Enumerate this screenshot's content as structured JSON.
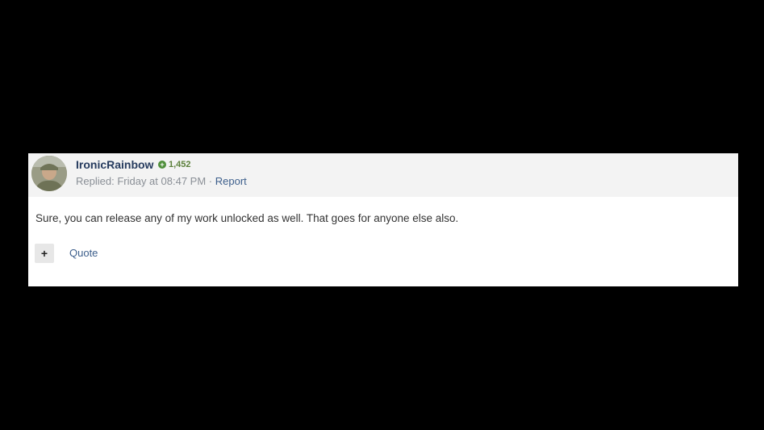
{
  "post": {
    "username": "IronicRainbow",
    "reputation_icon": "plus-circle-icon",
    "reputation": "1,452",
    "replied_label": "Replied:",
    "replied_time": "Friday at 08:47 PM",
    "separator": "·",
    "report_label": "Report",
    "body": "Sure, you can release any of my work unlocked as well. That goes for anyone else also.",
    "plus_label": "+",
    "quote_label": "Quote"
  },
  "colors": {
    "page_background": "#000000",
    "header_background": "#f3f3f3",
    "username": "#263b5e",
    "link": "#3d5f8c",
    "reputation": "#5b7f3a"
  }
}
